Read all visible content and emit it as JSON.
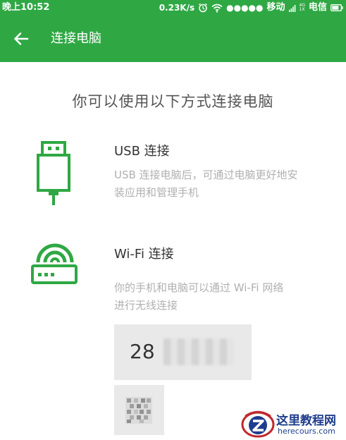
{
  "status_bar": {
    "time": "晚上10:52",
    "speed": "0.23K/s",
    "signal_dots": "●●●●●",
    "carrier1": "移动",
    "net_top": "4G",
    "net_bottom": "1X",
    "carrier2": "电信"
  },
  "app_bar": {
    "title": "连接电脑"
  },
  "main": {
    "heading": "你可以使用以下方式连接电脑",
    "usb": {
      "title": "USB 连接",
      "desc_line1": "USB 连接电脑后，可通过电脑更好地安",
      "desc_line2": "装应用和管理手机"
    },
    "wifi": {
      "title": "Wi-Fi 连接",
      "desc_line1": "你的手机和电脑可以通过 Wi-Fi 网络",
      "desc_line2": "进行无线连接",
      "code_visible": "28"
    }
  },
  "watermark": {
    "title": "这里教程网",
    "site": "herecours.com"
  },
  "colors": {
    "accent": "#2fa844",
    "icon": "#2fa844",
    "heading": "#555555",
    "desc": "#b0b0b0"
  }
}
